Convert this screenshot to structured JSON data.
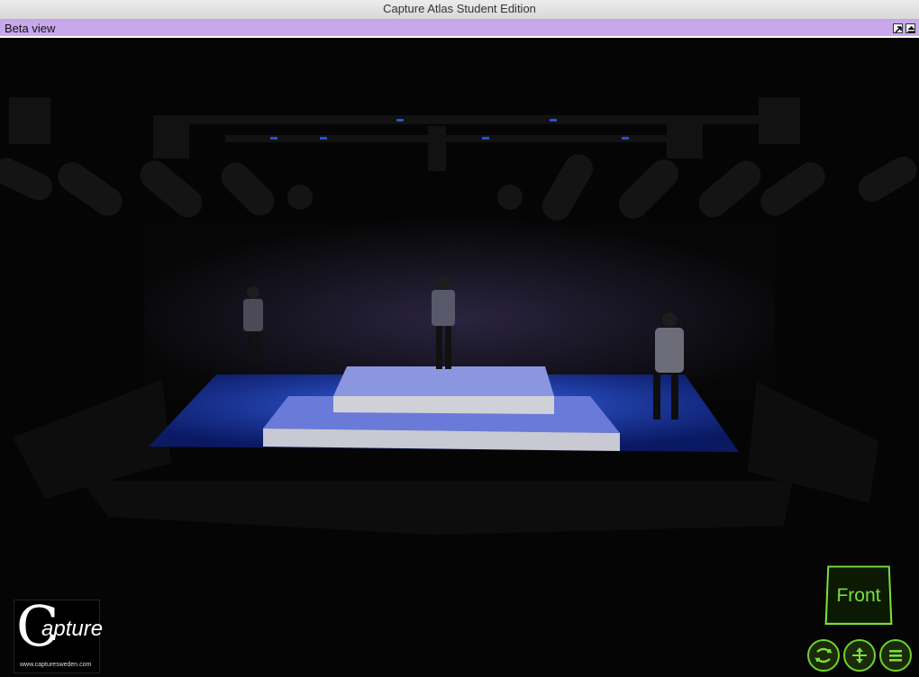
{
  "window": {
    "title": "Capture Atlas Student Edition"
  },
  "view": {
    "title": "Beta view"
  },
  "overlay": {
    "front_label": "Front",
    "logo_initial": "C",
    "logo_word": "apture",
    "logo_url": "www.capturesweden.com"
  },
  "colors": {
    "view_bar": "#c9a7ec",
    "nav_green": "#7be03a",
    "stage_light": "#1f4fd9"
  },
  "icons": {
    "rotate": "rotate-icon",
    "pan": "pan-icon",
    "menu": "menu-icon"
  }
}
